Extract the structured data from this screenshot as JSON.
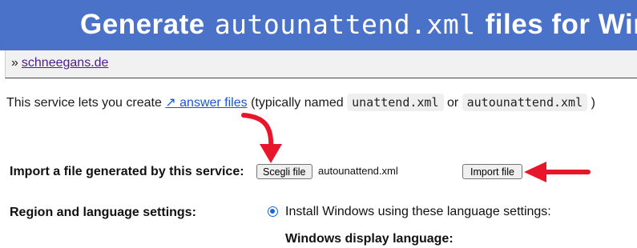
{
  "banner": {
    "title_prefix": "Generate",
    "title_mono": "autounattend.xml",
    "title_suffix": "files for Windows"
  },
  "breadcrumb": {
    "separator": "»",
    "link": "schneegans.de"
  },
  "intro": {
    "text_before": "This service lets you create ",
    "link": "↗ answer files",
    "text_middle": " (typically named ",
    "code1": "unattend.xml",
    "text_or": " or ",
    "code2": "autounattend.xml",
    "text_end": " )"
  },
  "import": {
    "label": "Import a file generated by this service:",
    "choose_button": "Scegli file",
    "file_name": "autounattend.xml",
    "import_button": "Import file"
  },
  "region": {
    "label": "Region and language settings:",
    "radio_label": "Install Windows using these language settings:",
    "subheading": "Windows display language:"
  },
  "colors": {
    "banner": "#4a72c8",
    "annotation_arrow": "#e8162b",
    "link": "#1a55d6"
  }
}
